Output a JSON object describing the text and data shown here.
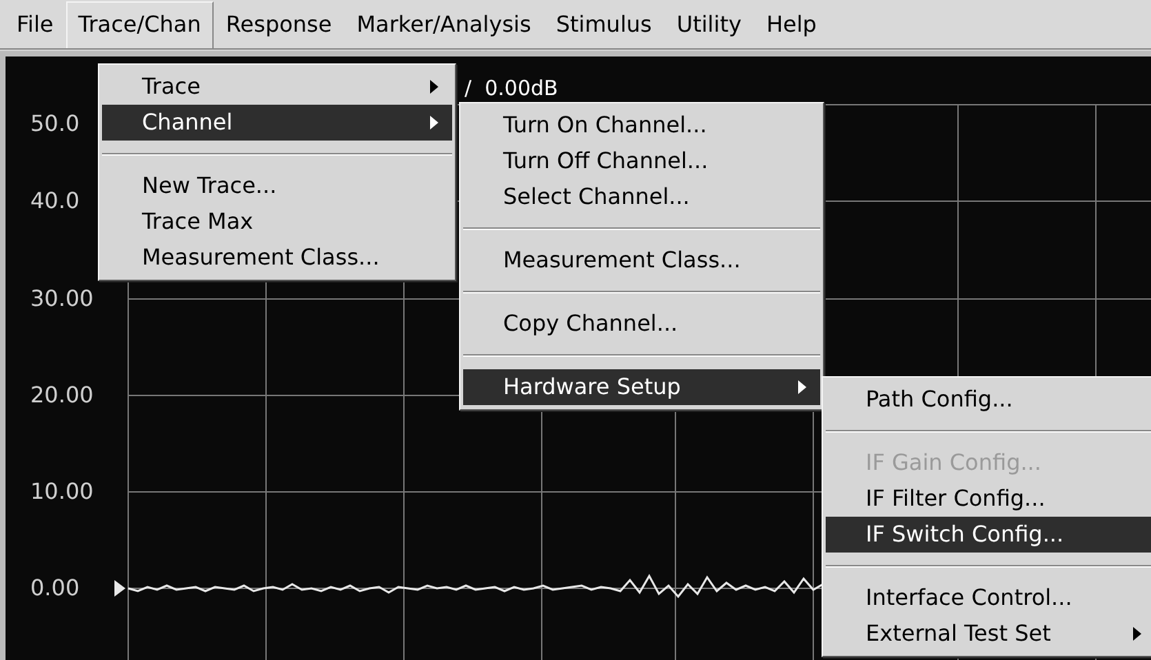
{
  "menu_bar": [
    {
      "label": "File",
      "selected": false
    },
    {
      "label": "Trace/Chan",
      "selected": true
    },
    {
      "label": "Response",
      "selected": false
    },
    {
      "label": "Marker/Analysis",
      "selected": false
    },
    {
      "label": "Stimulus",
      "selected": false
    },
    {
      "label": "Utility",
      "selected": false
    },
    {
      "label": "Help",
      "selected": false
    }
  ],
  "trace_header": "/  0.00dB",
  "y_axis_labels": [
    "50.0",
    "40.0",
    "30.00",
    "20.00",
    "10.00",
    "0.00"
  ],
  "menus": [
    {
      "items": [
        {
          "kind": "item",
          "label": "Trace",
          "has_submenu": true,
          "selected": false,
          "disabled": false
        },
        {
          "kind": "item",
          "label": "Channel",
          "has_submenu": true,
          "selected": true,
          "disabled": false
        },
        {
          "kind": "separator"
        },
        {
          "kind": "item",
          "label": "New Trace...",
          "has_submenu": false,
          "selected": false,
          "disabled": false
        },
        {
          "kind": "item",
          "label": "Trace Max",
          "has_submenu": false,
          "selected": false,
          "disabled": false
        },
        {
          "kind": "item",
          "label": "Measurement Class...",
          "has_submenu": false,
          "selected": false,
          "disabled": false
        }
      ]
    },
    {
      "items": [
        {
          "kind": "item",
          "label": "Turn On Channel...",
          "has_submenu": false,
          "selected": false,
          "disabled": false
        },
        {
          "kind": "item",
          "label": "Turn Off Channel...",
          "has_submenu": false,
          "selected": false,
          "disabled": false
        },
        {
          "kind": "item",
          "label": "Select Channel...",
          "has_submenu": false,
          "selected": false,
          "disabled": false
        },
        {
          "kind": "separator"
        },
        {
          "kind": "item",
          "label": "Measurement Class...",
          "has_submenu": false,
          "selected": false,
          "disabled": false
        },
        {
          "kind": "separator"
        },
        {
          "kind": "item",
          "label": "Copy Channel...",
          "has_submenu": false,
          "selected": false,
          "disabled": false
        },
        {
          "kind": "separator"
        },
        {
          "kind": "item",
          "label": "Hardware Setup",
          "has_submenu": true,
          "selected": true,
          "disabled": false
        }
      ]
    },
    {
      "items": [
        {
          "kind": "item",
          "label": "Path Config...",
          "has_submenu": false,
          "selected": false,
          "disabled": false
        },
        {
          "kind": "separator"
        },
        {
          "kind": "item",
          "label": "IF Gain Config...",
          "has_submenu": false,
          "selected": false,
          "disabled": true
        },
        {
          "kind": "item",
          "label": "IF Filter Config...",
          "has_submenu": false,
          "selected": false,
          "disabled": false
        },
        {
          "kind": "item",
          "label": "IF Switch Config...",
          "has_submenu": false,
          "selected": true,
          "disabled": false
        },
        {
          "kind": "separator"
        },
        {
          "kind": "item",
          "label": "Interface Control...",
          "has_submenu": false,
          "selected": false,
          "disabled": false
        },
        {
          "kind": "item",
          "label": "External Test Set",
          "has_submenu": true,
          "selected": false,
          "disabled": false
        }
      ]
    }
  ]
}
